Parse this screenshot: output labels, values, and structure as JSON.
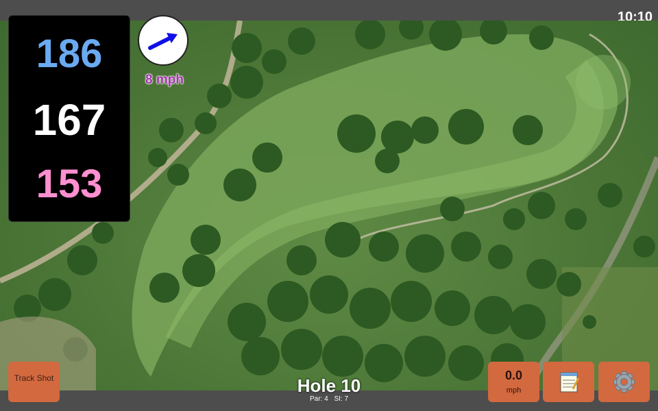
{
  "status": {
    "time": "10:10"
  },
  "distances": {
    "back": "186",
    "middle": "167",
    "front": "153"
  },
  "wind": {
    "speed": "8 mph",
    "direction_icon": "arrow-right-icon"
  },
  "hole": {
    "title": "Hole 10",
    "par": "Par: 4",
    "si": "SI: 7"
  },
  "buttons": {
    "track_shot": "Track Shot",
    "speed_value": "0.0",
    "speed_unit": "mph",
    "notes_icon": "notepad-icon",
    "settings_icon": "gear-icon"
  },
  "colors": {
    "back_distance": "#6aaaf0",
    "middle_distance": "#ffffff",
    "front_distance": "#ff8fd0",
    "button": "#d2693f",
    "wind_text": "#a733b0"
  }
}
